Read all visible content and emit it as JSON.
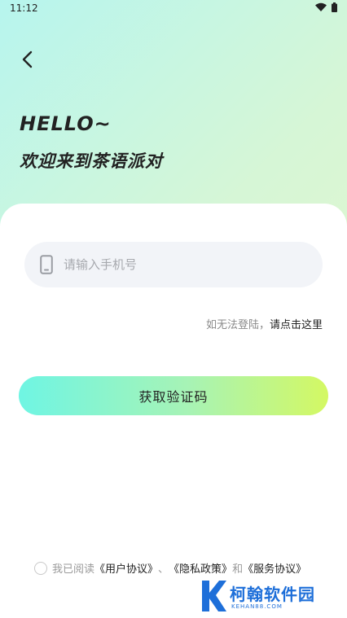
{
  "status_bar": {
    "time": "11:12"
  },
  "header": {
    "greeting": "HELLO~",
    "welcome": "欢迎来到茶语派对"
  },
  "login": {
    "phone_placeholder": "请输入手机号",
    "phone_value": "",
    "help_prefix": "如无法登陆，",
    "help_link": "请点击这里",
    "code_button_label": "获取验证码"
  },
  "agreement": {
    "prefix": "我已阅读",
    "user_agreement": "《用户协议》",
    "sep1": "、",
    "privacy_policy": "《隐私政策》",
    "sep2": "和",
    "service_agreement": "《服务协议》",
    "checked": false
  },
  "watermark": {
    "name": "柯翰软件园",
    "domain": "KEHAN88.COM"
  },
  "colors": {
    "accent_start": "#6ff5e3",
    "accent_end": "#d4f863",
    "watermark": "#1e6fd9"
  },
  "icons": [
    "back-arrow-icon",
    "wifi-icon",
    "battery-icon",
    "phone-icon"
  ]
}
